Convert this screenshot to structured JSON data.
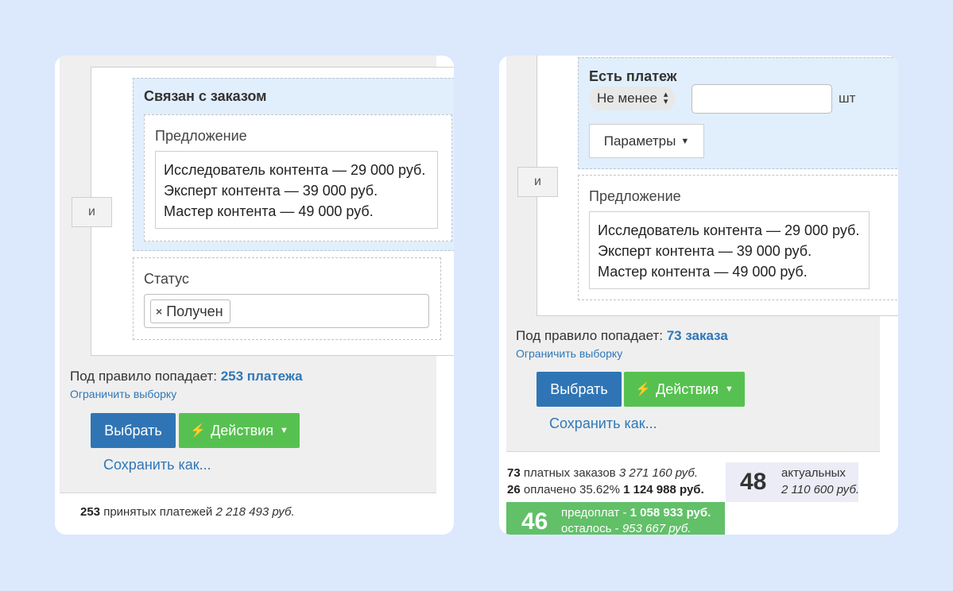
{
  "left": {
    "and_label": "и",
    "linked_title": "Связан с заказом",
    "offer_label": "Предложение",
    "offers": [
      "Исследователь контента — 29 000 руб.",
      "Эксперт контента — 39 000 руб.",
      "Мастер контента — 49 000 руб."
    ],
    "status_label": "Статус",
    "status_tag": "Получен",
    "status_tag_remove": "×",
    "hint_prefix": "Под правило попадает:",
    "hint_count": "253 платежа",
    "limit_link": "Ограничить выборку",
    "select_label": "Выбрать",
    "actions_label": "Действия",
    "save_as_label": "Сохранить как...",
    "summary": {
      "count": "253",
      "text": "принятых платежей",
      "sum": "2 218 493 руб."
    }
  },
  "right": {
    "payment_title": "Есть платеж",
    "compare_value": "Не менее",
    "quantity_value": "",
    "unit": "шт",
    "params_label": "Параметры",
    "and_label": "и",
    "offer_label": "Предложение",
    "offers": [
      "Исследователь контента — 29 000 руб.",
      "Эксперт контента — 39 000 руб.",
      "Мастер контента — 49 000 руб."
    ],
    "hint_prefix": "Под правило попадает:",
    "hint_count": "73 заказа",
    "limit_link": "Ограничить выборку",
    "select_label": "Выбрать",
    "actions_label": "Действия",
    "save_as_label": "Сохранить как...",
    "stats": {
      "paid_count": "73",
      "paid_text": "платных заказов",
      "paid_sum": "3 271 160 руб.",
      "payed_count": "26",
      "payed_text": "оплачено 35.62%",
      "payed_sum": "1 124 988 руб.",
      "actual_count": "48",
      "actual_text": "актуальных",
      "actual_sum": "2 110 600 руб.",
      "prepay_count": "46",
      "prepay_text": "предоплат -",
      "prepay_sum": "1 058 933 руб.",
      "remain_text": "осталось -",
      "remain_sum": "953 667 руб."
    }
  },
  "colors": {
    "background": "#dce8fc",
    "primary": "#2f75b5",
    "success": "#56c150",
    "link": "#2f78b8",
    "condition_bg": "#e1eefc"
  }
}
